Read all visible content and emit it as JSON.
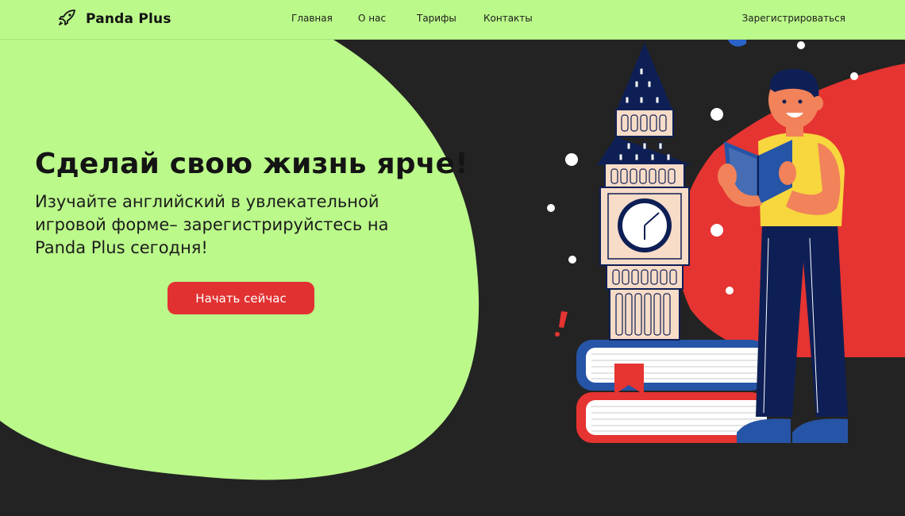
{
  "header": {
    "brand": "Panda Plus",
    "nav": [
      "Главная",
      "О нас",
      "Тарифы",
      "Контакты"
    ],
    "signup_label": "Зарегистрироваться",
    "logo_icon": "rocket-icon"
  },
  "hero": {
    "title": "Сделай свою жизнь ярче!",
    "subtitle": "Изучайте английский в увлекательной игровой форме– зарегистрируйстесь на Panda Plus сегодня!",
    "cta_label": "Начать сейчас"
  },
  "colors": {
    "green": "#bbf98a",
    "dark": "#232323",
    "red": "#e23131",
    "navy": "#0e1f55",
    "yellow": "#f7d63e",
    "blue": "#2654a6"
  }
}
